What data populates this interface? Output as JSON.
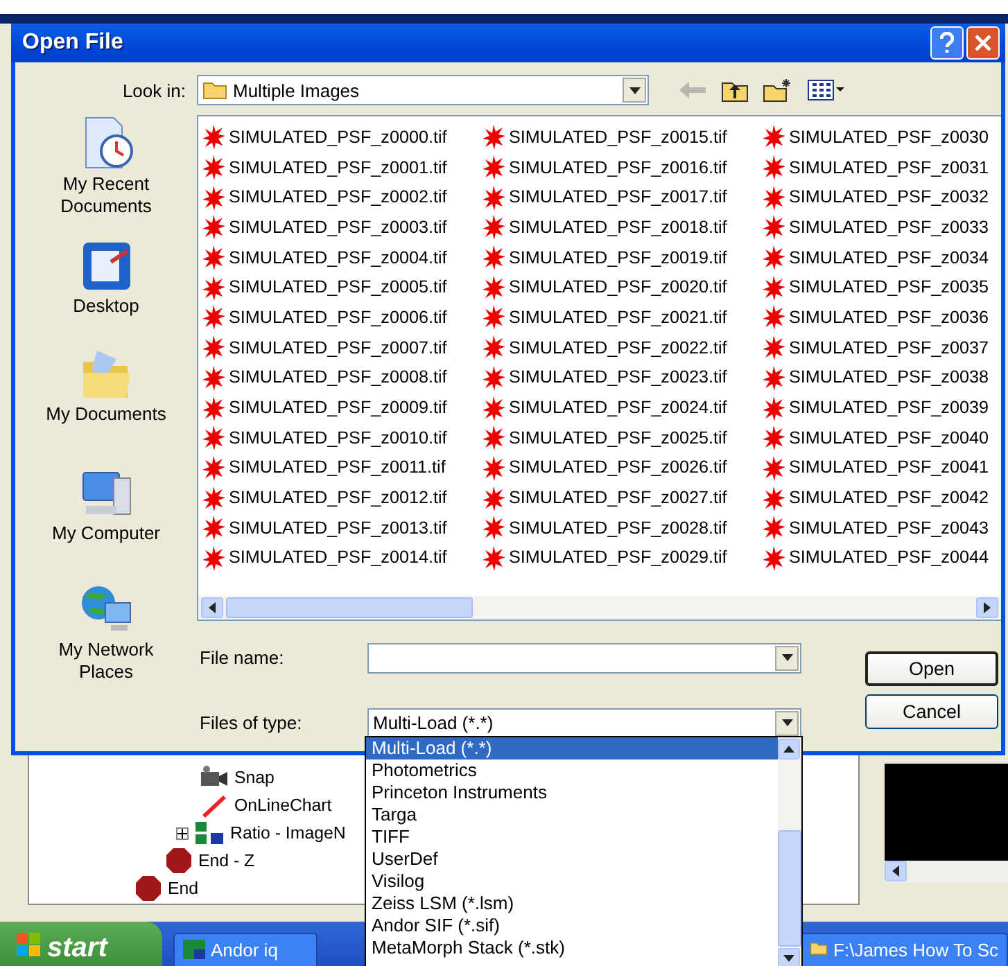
{
  "window": {
    "title": "Open File"
  },
  "look_in": {
    "label": "Look in:",
    "value": "Multiple Images"
  },
  "places": [
    {
      "label": "My Recent Documents",
      "kind": "recent"
    },
    {
      "label": "Desktop",
      "kind": "desktop"
    },
    {
      "label": "My Documents",
      "kind": "documents"
    },
    {
      "label": "My Computer",
      "kind": "computer"
    },
    {
      "label": "My Network Places",
      "kind": "network"
    }
  ],
  "files": [
    "SIMULATED_PSF_z0000.tif",
    "SIMULATED_PSF_z0001.tif",
    "SIMULATED_PSF_z0002.tif",
    "SIMULATED_PSF_z0003.tif",
    "SIMULATED_PSF_z0004.tif",
    "SIMULATED_PSF_z0005.tif",
    "SIMULATED_PSF_z0006.tif",
    "SIMULATED_PSF_z0007.tif",
    "SIMULATED_PSF_z0008.tif",
    "SIMULATED_PSF_z0009.tif",
    "SIMULATED_PSF_z0010.tif",
    "SIMULATED_PSF_z0011.tif",
    "SIMULATED_PSF_z0012.tif",
    "SIMULATED_PSF_z0013.tif",
    "SIMULATED_PSF_z0014.tif",
    "SIMULATED_PSF_z0015.tif",
    "SIMULATED_PSF_z0016.tif",
    "SIMULATED_PSF_z0017.tif",
    "SIMULATED_PSF_z0018.tif",
    "SIMULATED_PSF_z0019.tif",
    "SIMULATED_PSF_z0020.tif",
    "SIMULATED_PSF_z0021.tif",
    "SIMULATED_PSF_z0022.tif",
    "SIMULATED_PSF_z0023.tif",
    "SIMULATED_PSF_z0024.tif",
    "SIMULATED_PSF_z0025.tif",
    "SIMULATED_PSF_z0026.tif",
    "SIMULATED_PSF_z0027.tif",
    "SIMULATED_PSF_z0028.tif",
    "SIMULATED_PSF_z0029.tif",
    "SIMULATED_PSF_z0030",
    "SIMULATED_PSF_z0031",
    "SIMULATED_PSF_z0032",
    "SIMULATED_PSF_z0033",
    "SIMULATED_PSF_z0034",
    "SIMULATED_PSF_z0035",
    "SIMULATED_PSF_z0036",
    "SIMULATED_PSF_z0037",
    "SIMULATED_PSF_z0038",
    "SIMULATED_PSF_z0039",
    "SIMULATED_PSF_z0040",
    "SIMULATED_PSF_z0041",
    "SIMULATED_PSF_z0042",
    "SIMULATED_PSF_z0043",
    "SIMULATED_PSF_z0044"
  ],
  "file_name": {
    "label": "File name:"
  },
  "file_type": {
    "label": "Files of type:",
    "value": "Multi-Load (*.*)"
  },
  "buttons": [
    "Open",
    "Cancel"
  ],
  "type_options": [
    {
      "label": "Multi-Load (*.*)",
      "selected": true
    },
    {
      "label": "Photometrics",
      "selected": false
    },
    {
      "label": "Princeton Instruments",
      "selected": false
    },
    {
      "label": "Targa",
      "selected": false
    },
    {
      "label": "TIFF",
      "selected": false
    },
    {
      "label": "UserDef",
      "selected": false
    },
    {
      "label": "Visilog",
      "selected": false
    },
    {
      "label": "Zeiss LSM (*.lsm)",
      "selected": false
    },
    {
      "label": "Andor SIF (*.sif)",
      "selected": false
    },
    {
      "label": "MetaMorph Stack (*.stk)",
      "selected": false
    }
  ],
  "tree": [
    {
      "label": "Snap",
      "kind": "camera"
    },
    {
      "label": "OnLineChart",
      "kind": "pen"
    },
    {
      "label": "Ratio - ImageN",
      "kind": "ratio"
    },
    {
      "label": "End - Z",
      "kind": "stop"
    },
    {
      "label": "End",
      "kind": "stop"
    }
  ],
  "taskbar": {
    "start": "start",
    "tasks": [
      "Andor iq",
      "F:\\James How To Sc"
    ]
  }
}
